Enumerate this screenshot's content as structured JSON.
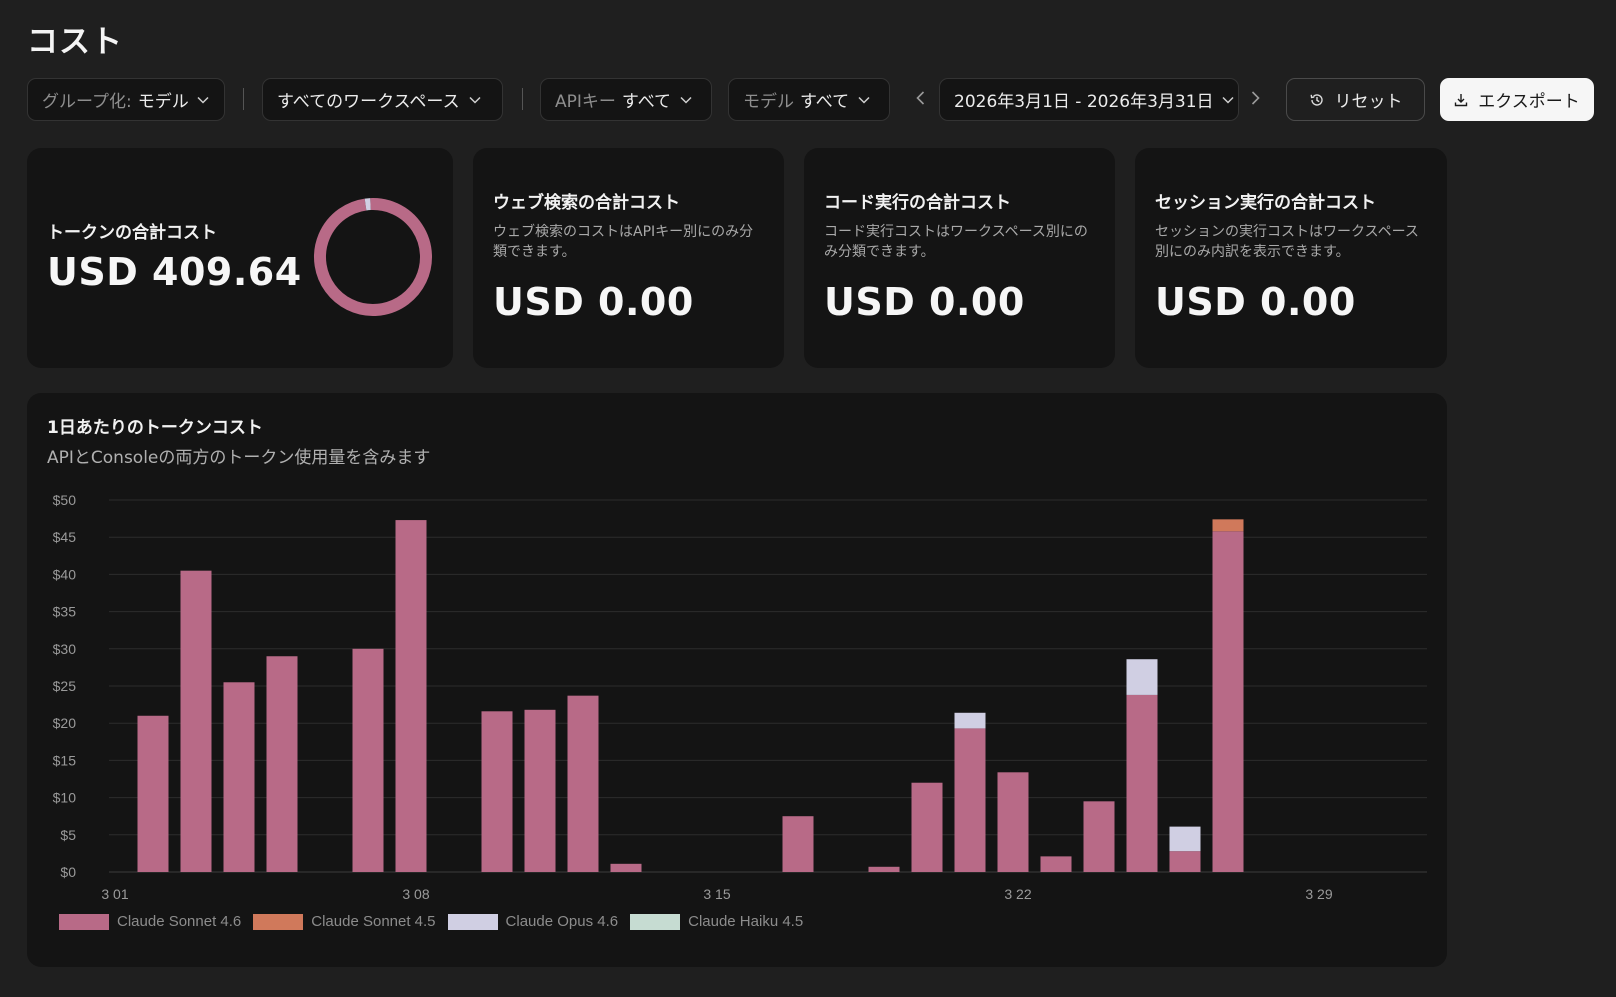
{
  "page": {
    "title": "コスト"
  },
  "toolbar": {
    "group_by": {
      "label": "グループ化:",
      "value": "モデル"
    },
    "workspace": {
      "value": "すべてのワークスペース"
    },
    "api_key": {
      "label": "APIキー",
      "value": "すべて"
    },
    "model": {
      "label": "モデル",
      "value": "すべて"
    },
    "date_range": "2026年3月1日 - 2026年3月31日",
    "reset_label": "リセット",
    "export_label": "エクスポート"
  },
  "cards": {
    "tokens": {
      "title": "トークンの合計コスト",
      "value": "USD 409.64"
    },
    "web_search": {
      "title": "ウェブ検索の合計コスト",
      "desc": "ウェブ検索のコストはAPIキー別にのみ分類できます。",
      "value": "USD 0.00"
    },
    "code_exec": {
      "title": "コード実行の合計コスト",
      "desc": "コード実行コストはワークスペース別にのみ分類できます。",
      "value": "USD 0.00"
    },
    "session_exec": {
      "title": "セッション実行の合計コスト",
      "desc": "セッションの実行コストはワークスペース別にのみ内訳を表示できます。",
      "value": "USD 0.00"
    }
  },
  "donut": {
    "segments": [
      {
        "name": "Claude Sonnet 4.6",
        "share": 0.985,
        "color": "#b86a87"
      },
      {
        "name": "Claude Opus 4.6",
        "share": 0.015,
        "color": "#d0cfe3"
      }
    ]
  },
  "chart": {
    "title": "1日あたりのトークンコスト",
    "subtitle": "APIとConsoleの両方のトークン使用量を含みます"
  },
  "chart_data": {
    "type": "bar",
    "stacked": true,
    "x": [
      "3 01",
      "3 02",
      "3 03",
      "3 04",
      "3 05",
      "3 06",
      "3 07",
      "3 08",
      "3 09",
      "3 10",
      "3 11",
      "3 12",
      "3 13",
      "3 14",
      "3 15",
      "3 16",
      "3 17",
      "3 18",
      "3 19",
      "3 20",
      "3 21",
      "3 22",
      "3 23",
      "3 24",
      "3 25",
      "3 26",
      "3 27",
      "3 28",
      "3 29",
      "3 30",
      "3 31"
    ],
    "xticks": [
      "3 01",
      "3 08",
      "3 15",
      "3 22",
      "3 29"
    ],
    "yticks": [
      "$0",
      "$5",
      "$10",
      "$15",
      "$20",
      "$25",
      "$30",
      "$35",
      "$40",
      "$45",
      "$50"
    ],
    "ylim": [
      0,
      50
    ],
    "grid": true,
    "legend_position": "bottom-left",
    "series": [
      {
        "name": "Claude Sonnet 4.6",
        "color": "#b86a87",
        "values": [
          0,
          21,
          40.5,
          25.5,
          29,
          0,
          30,
          47.3,
          0,
          21.6,
          21.8,
          23.7,
          1.1,
          0,
          0,
          0,
          7.5,
          0,
          0.7,
          12,
          19.3,
          13.4,
          2.1,
          9.5,
          23.8,
          2.8,
          45.8,
          0,
          0,
          0,
          0
        ]
      },
      {
        "name": "Claude Sonnet 4.5",
        "color": "#d0795b",
        "values": [
          0,
          0,
          0,
          0,
          0,
          0,
          0,
          0,
          0,
          0,
          0,
          0,
          0,
          0,
          0,
          0,
          0,
          0,
          0,
          0,
          0,
          0,
          0,
          0,
          0,
          0,
          1.6,
          0,
          0,
          0,
          0
        ]
      },
      {
        "name": "Claude Opus 4.6",
        "color": "#d0cfe3",
        "values": [
          0,
          0,
          0,
          0,
          0,
          0,
          0,
          0,
          0,
          0,
          0,
          0,
          0,
          0,
          0,
          0,
          0,
          0,
          0,
          0,
          2.1,
          0,
          0,
          0,
          4.8,
          3.3,
          0,
          0,
          0,
          0,
          0
        ]
      },
      {
        "name": "Claude Haiku 4.5",
        "color": "#c6dcd2",
        "values": [
          0,
          0,
          0,
          0,
          0,
          0,
          0,
          0,
          0,
          0,
          0,
          0,
          0,
          0,
          0,
          0,
          0,
          0,
          0,
          0,
          0,
          0,
          0,
          0,
          0,
          0,
          0,
          0,
          0,
          0,
          0
        ]
      }
    ]
  }
}
